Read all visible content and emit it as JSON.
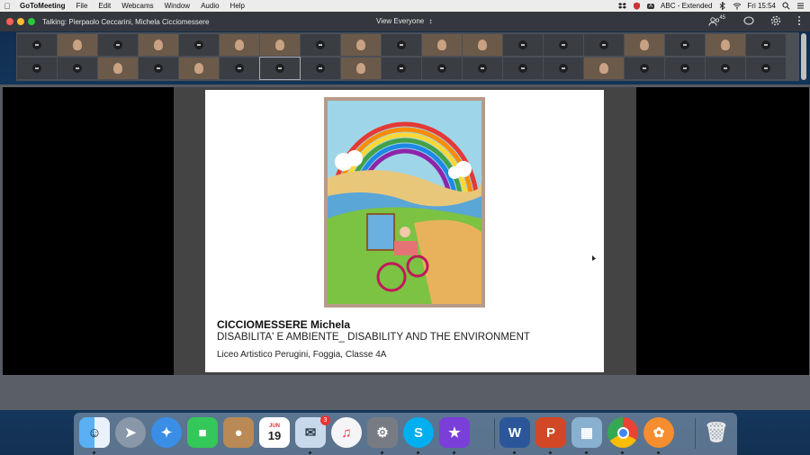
{
  "menubar": {
    "app": "GoToMeeting",
    "items": [
      "File",
      "Edit",
      "Webcams",
      "Window",
      "Audio",
      "Help"
    ],
    "input_source": "ABC - Extended",
    "clock": "Fri 15:54"
  },
  "titlebar": {
    "talking": "Talking: Pierpaolo Ceccarini, Michela Cicciomessere",
    "view_selector": "View Everyone",
    "attendee_count": "45"
  },
  "slide": {
    "author": "CICCIOMESSERE Michela",
    "title": "DISABILITA' E AMBIENTE_ DISABILITY AND THE ENVIRONMENT",
    "school": "Liceo  Artistico Perugini, Foggia, Classe 4A"
  },
  "dock": {
    "calendar_month": "JUN",
    "calendar_day": "19",
    "mail_badge": "3",
    "apps": [
      "finder-icon",
      "launchpad-icon",
      "safari-icon",
      "facetime-icon",
      "contacts-icon",
      "calendar-icon",
      "mail-icon",
      "music-icon",
      "system-preferences-icon",
      "skype-icon",
      "imovie-icon",
      "word-icon",
      "powerpoint-icon",
      "preview-icon",
      "chrome-icon",
      "gotomeeting-icon",
      "trash-icon"
    ]
  },
  "colors": {
    "close": "#fe5f57",
    "minimize": "#febc2e",
    "zoom": "#28c840",
    "titlebar": "#34373d",
    "grid": "#4b4f56"
  }
}
